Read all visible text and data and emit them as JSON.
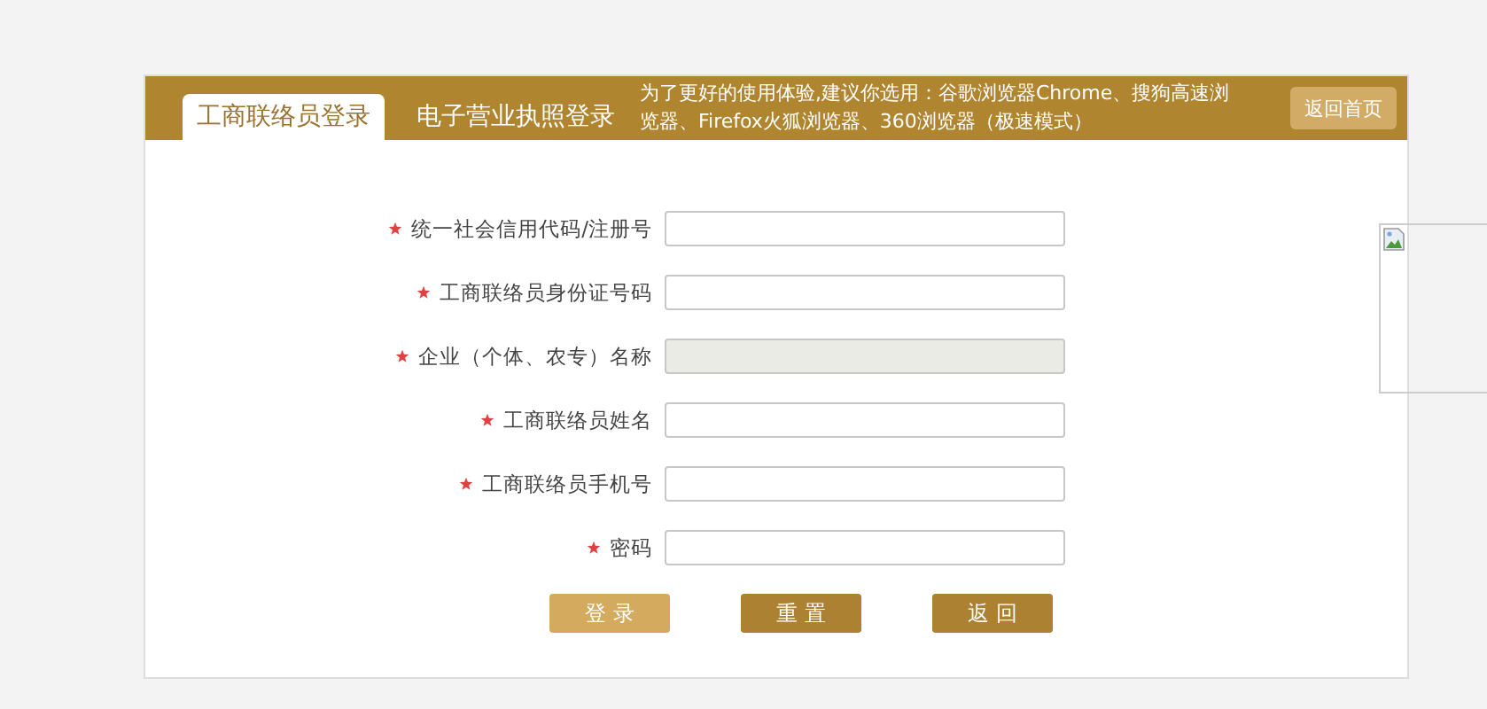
{
  "tabs": [
    {
      "label": "工商联络员登录",
      "selected": true
    },
    {
      "label": "电子营业执照登录",
      "selected": false
    }
  ],
  "notice": "为了更好的使用体验,建议你选用：谷歌浏览器Chrome、搜狗高速浏览器、Firefox火狐浏览器、360浏览器（极速模式）",
  "home_button": "返回首页",
  "fields": [
    {
      "label": "统一社会信用代码/注册号",
      "required": true,
      "disabled": false
    },
    {
      "label": "工商联络员身份证号码",
      "required": true,
      "disabled": false
    },
    {
      "label": "企业（个体、农专）名称",
      "required": true,
      "disabled": true
    },
    {
      "label": "工商联络员姓名",
      "required": true,
      "disabled": false
    },
    {
      "label": "工商联络员手机号",
      "required": true,
      "disabled": false
    },
    {
      "label": "密码",
      "required": true,
      "disabled": false
    }
  ],
  "buttons": [
    {
      "label": "登 录",
      "kind": "primary"
    },
    {
      "label": "重 置",
      "kind": "secondary"
    },
    {
      "label": "返 回",
      "kind": "secondary"
    }
  ],
  "side_image": {
    "kind": "broken-image"
  }
}
